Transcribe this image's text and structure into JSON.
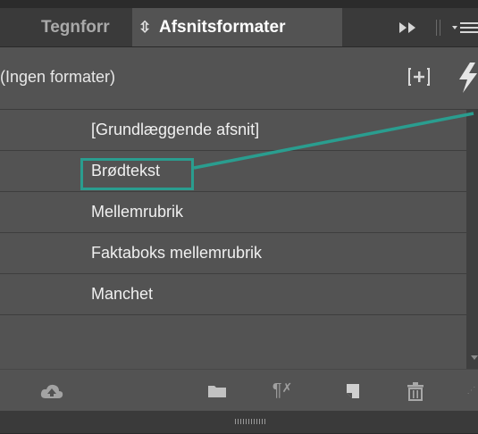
{
  "tabs": {
    "inactive_label": "Tegnforr",
    "active_label": "Afsnitsformater",
    "switch_icon": "up-down-arrows-icon",
    "expand_icon": "double-chevron-right-icon",
    "menu_icon": "panel-menu-icon"
  },
  "toolbar": {
    "current_style": "(Ingen formater)",
    "new_group_icon": "new-style-group-icon",
    "quick_apply_icon": "lightning-icon"
  },
  "styles": [
    {
      "label": "[Grundlæggende afsnit]"
    },
    {
      "label": "Brødtekst"
    },
    {
      "label": "Mellemrubrik"
    },
    {
      "label": "Faktaboks mellemrubrik"
    },
    {
      "label": "Manchet"
    }
  ],
  "highlight": {
    "target": "Brødtekst",
    "color": "#2a9d8f"
  },
  "bottom_icons": [
    "cc-libraries-icon",
    "folder-icon",
    "clear-overrides-icon",
    "new-style-icon",
    "trash-icon"
  ],
  "colors": {
    "panel_bg": "#535353",
    "tabbar_bg": "#3a3a3a",
    "text": "#f0f0f0",
    "accent": "#2a9d8f"
  }
}
